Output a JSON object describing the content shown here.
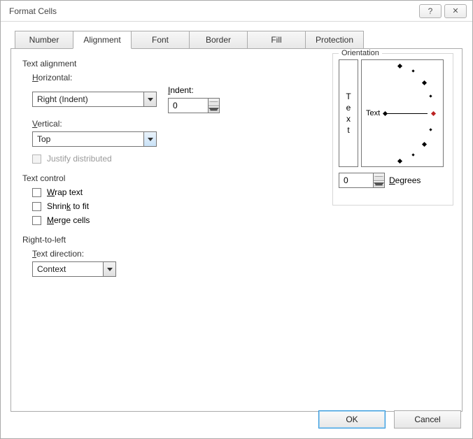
{
  "title": "Format Cells",
  "tabs": [
    "Number",
    "Alignment",
    "Font",
    "Border",
    "Fill",
    "Protection"
  ],
  "active_tab": 1,
  "text_alignment": {
    "heading": "Text alignment",
    "horizontal_label": "Horizontal:",
    "horizontal_value": "Right (Indent)",
    "indent_label": "Indent:",
    "indent_value": "0",
    "vertical_label": "Vertical:",
    "vertical_value": "Top",
    "justify_label": "Justify distributed"
  },
  "text_control": {
    "heading": "Text control",
    "wrap": "Wrap text",
    "shrink": "Shrink to fit",
    "merge": "Merge cells"
  },
  "rtl": {
    "heading": "Right-to-left",
    "direction_label": "Text direction:",
    "direction_value": "Context"
  },
  "orientation": {
    "heading": "Orientation",
    "vtext": [
      "T",
      "e",
      "x",
      "t"
    ],
    "htext": "Text",
    "degrees_value": "0",
    "degrees_label": "Degrees"
  },
  "buttons": {
    "ok": "OK",
    "cancel": "Cancel"
  }
}
